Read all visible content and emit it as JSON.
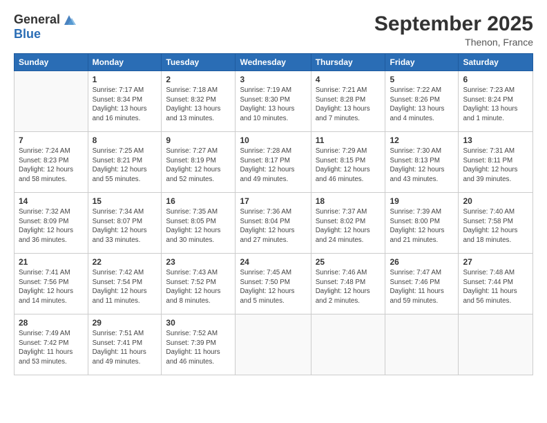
{
  "header": {
    "logo_general": "General",
    "logo_blue": "Blue",
    "title": "September 2025",
    "subtitle": "Thenon, France"
  },
  "days_of_week": [
    "Sunday",
    "Monday",
    "Tuesday",
    "Wednesday",
    "Thursday",
    "Friday",
    "Saturday"
  ],
  "weeks": [
    [
      {
        "day": "",
        "info": ""
      },
      {
        "day": "1",
        "info": "Sunrise: 7:17 AM\nSunset: 8:34 PM\nDaylight: 13 hours\nand 16 minutes."
      },
      {
        "day": "2",
        "info": "Sunrise: 7:18 AM\nSunset: 8:32 PM\nDaylight: 13 hours\nand 13 minutes."
      },
      {
        "day": "3",
        "info": "Sunrise: 7:19 AM\nSunset: 8:30 PM\nDaylight: 13 hours\nand 10 minutes."
      },
      {
        "day": "4",
        "info": "Sunrise: 7:21 AM\nSunset: 8:28 PM\nDaylight: 13 hours\nand 7 minutes."
      },
      {
        "day": "5",
        "info": "Sunrise: 7:22 AM\nSunset: 8:26 PM\nDaylight: 13 hours\nand 4 minutes."
      },
      {
        "day": "6",
        "info": "Sunrise: 7:23 AM\nSunset: 8:24 PM\nDaylight: 13 hours\nand 1 minute."
      }
    ],
    [
      {
        "day": "7",
        "info": "Sunrise: 7:24 AM\nSunset: 8:23 PM\nDaylight: 12 hours\nand 58 minutes."
      },
      {
        "day": "8",
        "info": "Sunrise: 7:25 AM\nSunset: 8:21 PM\nDaylight: 12 hours\nand 55 minutes."
      },
      {
        "day": "9",
        "info": "Sunrise: 7:27 AM\nSunset: 8:19 PM\nDaylight: 12 hours\nand 52 minutes."
      },
      {
        "day": "10",
        "info": "Sunrise: 7:28 AM\nSunset: 8:17 PM\nDaylight: 12 hours\nand 49 minutes."
      },
      {
        "day": "11",
        "info": "Sunrise: 7:29 AM\nSunset: 8:15 PM\nDaylight: 12 hours\nand 46 minutes."
      },
      {
        "day": "12",
        "info": "Sunrise: 7:30 AM\nSunset: 8:13 PM\nDaylight: 12 hours\nand 43 minutes."
      },
      {
        "day": "13",
        "info": "Sunrise: 7:31 AM\nSunset: 8:11 PM\nDaylight: 12 hours\nand 39 minutes."
      }
    ],
    [
      {
        "day": "14",
        "info": "Sunrise: 7:32 AM\nSunset: 8:09 PM\nDaylight: 12 hours\nand 36 minutes."
      },
      {
        "day": "15",
        "info": "Sunrise: 7:34 AM\nSunset: 8:07 PM\nDaylight: 12 hours\nand 33 minutes."
      },
      {
        "day": "16",
        "info": "Sunrise: 7:35 AM\nSunset: 8:05 PM\nDaylight: 12 hours\nand 30 minutes."
      },
      {
        "day": "17",
        "info": "Sunrise: 7:36 AM\nSunset: 8:04 PM\nDaylight: 12 hours\nand 27 minutes."
      },
      {
        "day": "18",
        "info": "Sunrise: 7:37 AM\nSunset: 8:02 PM\nDaylight: 12 hours\nand 24 minutes."
      },
      {
        "day": "19",
        "info": "Sunrise: 7:39 AM\nSunset: 8:00 PM\nDaylight: 12 hours\nand 21 minutes."
      },
      {
        "day": "20",
        "info": "Sunrise: 7:40 AM\nSunset: 7:58 PM\nDaylight: 12 hours\nand 18 minutes."
      }
    ],
    [
      {
        "day": "21",
        "info": "Sunrise: 7:41 AM\nSunset: 7:56 PM\nDaylight: 12 hours\nand 14 minutes."
      },
      {
        "day": "22",
        "info": "Sunrise: 7:42 AM\nSunset: 7:54 PM\nDaylight: 12 hours\nand 11 minutes."
      },
      {
        "day": "23",
        "info": "Sunrise: 7:43 AM\nSunset: 7:52 PM\nDaylight: 12 hours\nand 8 minutes."
      },
      {
        "day": "24",
        "info": "Sunrise: 7:45 AM\nSunset: 7:50 PM\nDaylight: 12 hours\nand 5 minutes."
      },
      {
        "day": "25",
        "info": "Sunrise: 7:46 AM\nSunset: 7:48 PM\nDaylight: 12 hours\nand 2 minutes."
      },
      {
        "day": "26",
        "info": "Sunrise: 7:47 AM\nSunset: 7:46 PM\nDaylight: 11 hours\nand 59 minutes."
      },
      {
        "day": "27",
        "info": "Sunrise: 7:48 AM\nSunset: 7:44 PM\nDaylight: 11 hours\nand 56 minutes."
      }
    ],
    [
      {
        "day": "28",
        "info": "Sunrise: 7:49 AM\nSunset: 7:42 PM\nDaylight: 11 hours\nand 53 minutes."
      },
      {
        "day": "29",
        "info": "Sunrise: 7:51 AM\nSunset: 7:41 PM\nDaylight: 11 hours\nand 49 minutes."
      },
      {
        "day": "30",
        "info": "Sunrise: 7:52 AM\nSunset: 7:39 PM\nDaylight: 11 hours\nand 46 minutes."
      },
      {
        "day": "",
        "info": ""
      },
      {
        "day": "",
        "info": ""
      },
      {
        "day": "",
        "info": ""
      },
      {
        "day": "",
        "info": ""
      }
    ]
  ]
}
